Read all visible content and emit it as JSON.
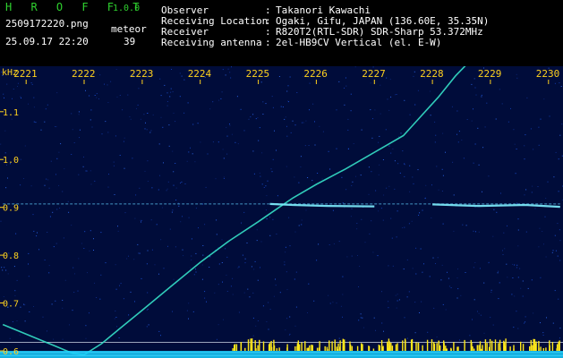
{
  "header": {
    "app_title": "H R O F F T",
    "app_version": "1.0.0",
    "file_name": "2509172220.png",
    "date_time": "25.09.17 22:20",
    "meteor_label": "meteor",
    "meteor_count": "39",
    "info": [
      {
        "label": "Observer",
        "value": "Takanori Kawachi"
      },
      {
        "label": "Receiving Location",
        "value": "Ogaki, Gifu, JAPAN (136.60E, 35.35N)"
      },
      {
        "label": "Receiver",
        "value": "R820T2(RTL-SDR) SDR-Sharp 53.372MHz"
      },
      {
        "label": "Receiving antenna",
        "value": "2el-HB9CV Vertical (el. E-W)"
      }
    ],
    "separator": ":"
  },
  "colors": {
    "background": "#000c3a",
    "axis_text": "#ffd21e",
    "title": "#2fd12f",
    "trace": "#35e0c8",
    "carrier": "#5fd0ff",
    "noise_floor": "#1ad0ff",
    "burst": "#ffe81a"
  },
  "chart_data": {
    "type": "heatmap",
    "x_unit": "",
    "y_unit": "kHz",
    "x_ticks": [
      "2221",
      "2222",
      "2223",
      "2224",
      "2225",
      "2226",
      "2227",
      "2228",
      "2229",
      "2230"
    ],
    "x_tick_values": [
      2221,
      2222,
      2223,
      2224,
      2225,
      2226,
      2227,
      2228,
      2229,
      2230
    ],
    "y_ticks": [
      "1.1",
      "1.0",
      "0.9",
      "0.8",
      "0.7",
      "0.6"
    ],
    "y_tick_values": [
      1.1,
      1.0,
      0.9,
      0.8,
      0.7,
      0.6
    ],
    "xlim": [
      2220.55,
      2230.25
    ],
    "ylim": [
      0.585,
      1.195
    ],
    "series": [
      {
        "kind": "trace",
        "points": [
          [
            2220.6,
            0.655
          ],
          [
            2220.9,
            0.64
          ],
          [
            2221.2,
            0.625
          ],
          [
            2221.5,
            0.61
          ],
          [
            2221.8,
            0.595
          ],
          [
            2222.0,
            0.592
          ],
          [
            2222.3,
            0.615
          ],
          [
            2222.6,
            0.645
          ],
          [
            2223.0,
            0.685
          ],
          [
            2223.5,
            0.735
          ],
          [
            2224.0,
            0.785
          ],
          [
            2224.5,
            0.83
          ],
          [
            2225.0,
            0.87
          ],
          [
            2225.3,
            0.895
          ],
          [
            2225.6,
            0.92
          ],
          [
            2226.0,
            0.948
          ],
          [
            2226.5,
            0.98
          ],
          [
            2227.0,
            1.015
          ],
          [
            2227.5,
            1.05
          ],
          [
            2227.8,
            1.09
          ],
          [
            2228.1,
            1.13
          ],
          [
            2228.4,
            1.175
          ],
          [
            2228.6,
            1.2
          ]
        ]
      },
      {
        "kind": "carrier",
        "points": [
          [
            2220.6,
            0.907
          ],
          [
            2230.2,
            0.907
          ]
        ]
      },
      {
        "kind": "echo",
        "points": [
          [
            2225.2,
            0.907
          ],
          [
            2225.6,
            0.905
          ],
          [
            2226.2,
            0.903
          ],
          [
            2227.0,
            0.902
          ]
        ]
      },
      {
        "kind": "echo",
        "points": [
          [
            2228.0,
            0.906
          ],
          [
            2228.8,
            0.903
          ],
          [
            2229.6,
            0.905
          ],
          [
            2230.2,
            0.901
          ]
        ]
      }
    ],
    "reference_lines": [
      0.618,
      0.597,
      0.59
    ]
  }
}
